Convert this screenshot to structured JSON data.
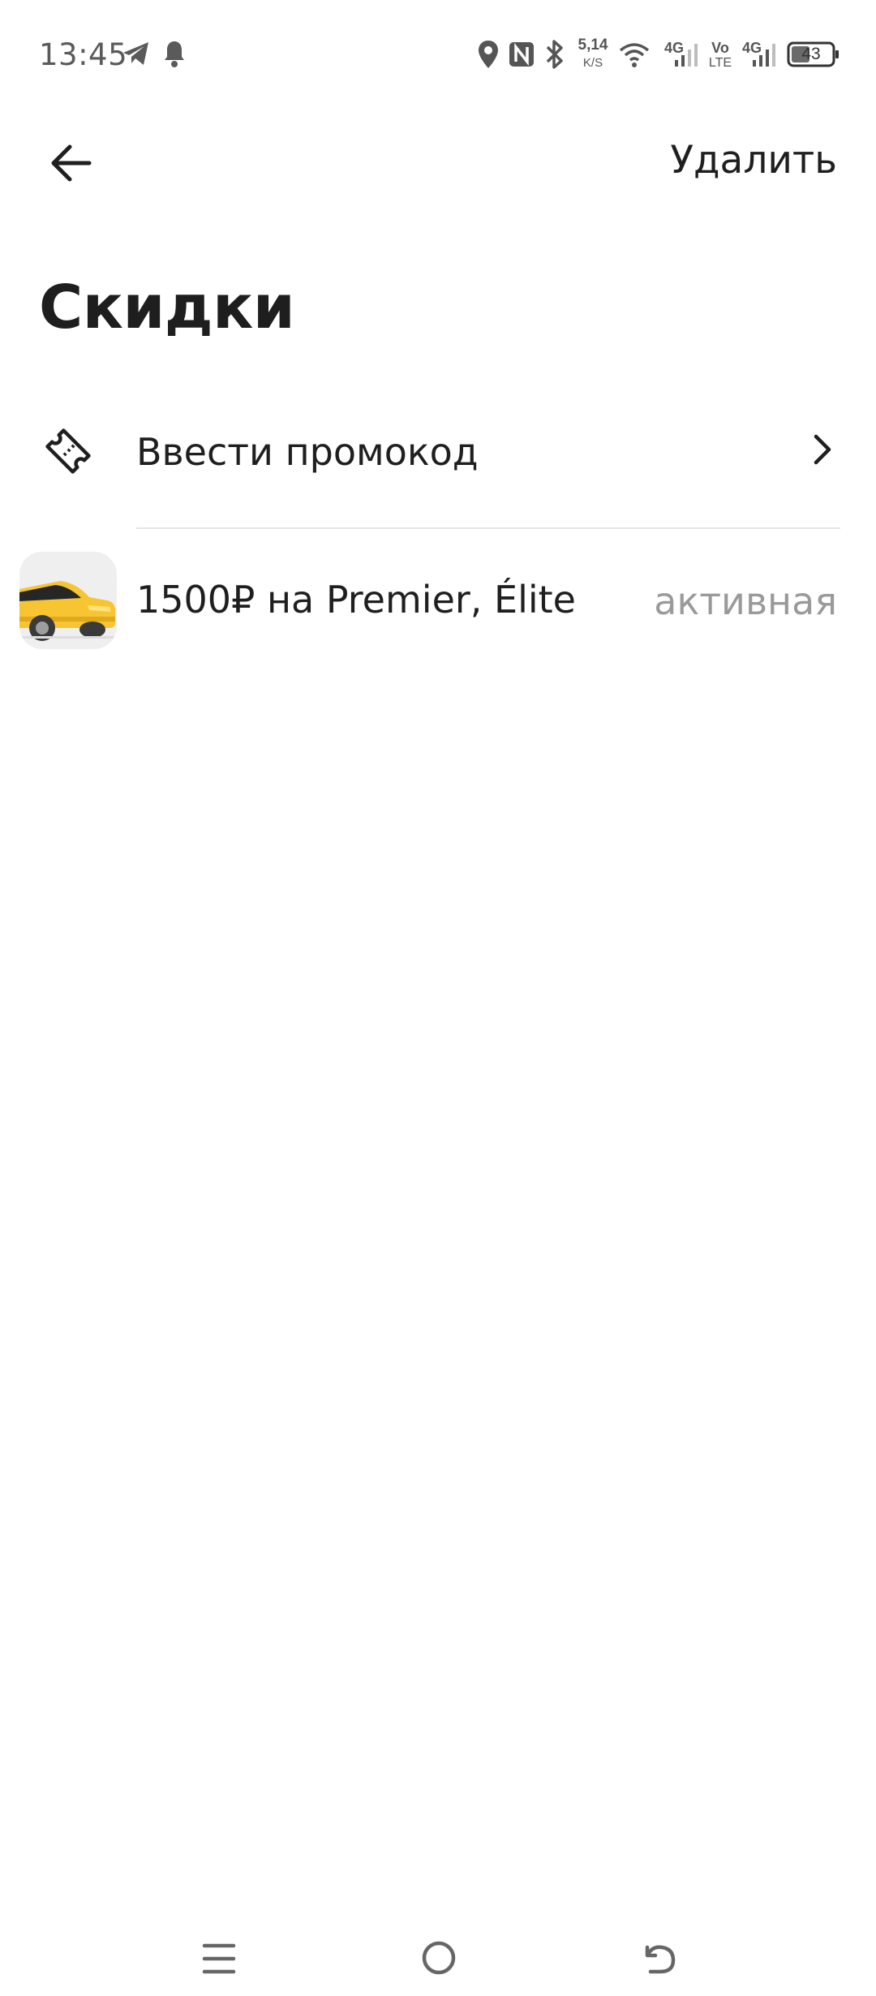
{
  "status_bar": {
    "time": "13:45",
    "net_speed_value": "5,14",
    "net_speed_unit": "K/S",
    "network_4g_1": "4G",
    "volte_top": "Vo",
    "volte_bottom": "LTE",
    "network_4g_2": "4G",
    "battery_level": "43",
    "icons": [
      "telegram-icon",
      "bell-icon",
      "location-icon",
      "nfc-icon",
      "bluetooth-icon",
      "wifi-icon",
      "signal-icon",
      "battery-icon"
    ]
  },
  "header": {
    "delete_label": "Удалить"
  },
  "page": {
    "title": "Скидки"
  },
  "list": {
    "promo_row": {
      "label": "Ввести промокод",
      "icon": "ticket-icon"
    },
    "discount_row": {
      "label": "1500₽ на Premier, Élite",
      "status": "активная",
      "icon": "car-icon"
    }
  },
  "nav": {
    "icons": [
      "menu-icon",
      "home-icon",
      "back-nav-icon"
    ]
  },
  "colors": {
    "text_primary": "#1f1f1f",
    "text_secondary": "#9a9a9a",
    "car_yellow": "#f6c531",
    "thumb_bg": "#efefef",
    "divider": "#e6e6e6"
  }
}
